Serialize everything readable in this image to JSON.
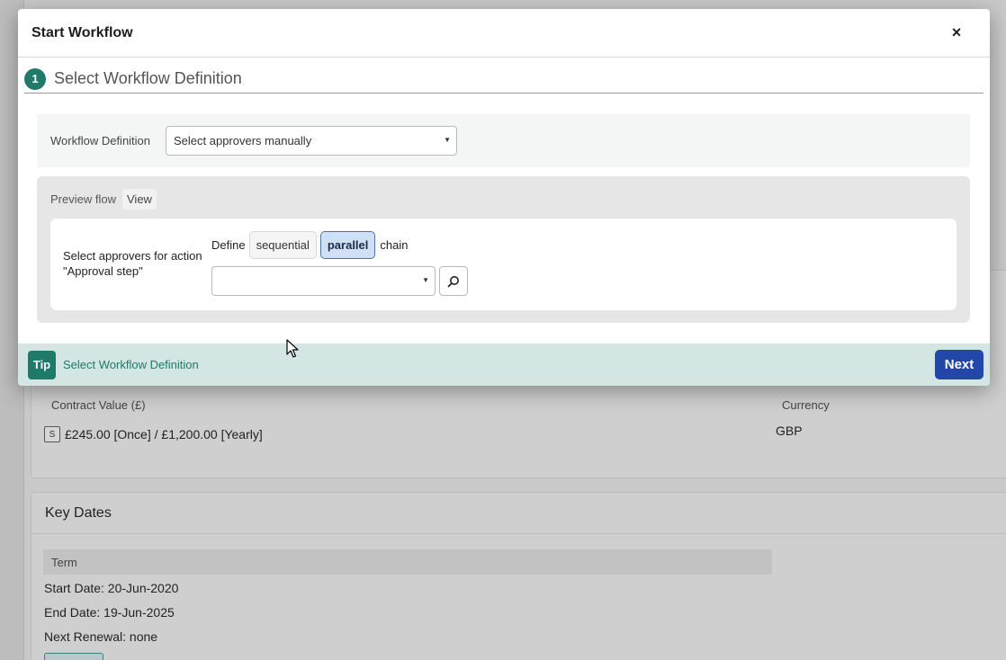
{
  "background": {
    "contract": {
      "value_label": "Contract Value (£)",
      "currency_label": "Currency",
      "value_badge": "S",
      "value_text": "£245.00 [Once] / £1,200.00 [Yearly]",
      "currency_value": "GBP"
    },
    "key_dates": {
      "heading": "Key Dates",
      "term_label": "Term",
      "start_date": "Start Date: 20-Jun-2020",
      "end_date": "End Date: 19-Jun-2025",
      "next_renewal": "Next Renewal: none"
    }
  },
  "modal": {
    "title": "Start Workflow",
    "close_glyph": "×",
    "step": {
      "number": "1",
      "title": "Select Workflow Definition"
    },
    "definition": {
      "label": "Workflow Definition",
      "selected": "Select approvers manually"
    },
    "preview": {
      "label": "Preview flow",
      "view_label": "View"
    },
    "approvers": {
      "label": "Select approvers for action \"Approval step\"",
      "define_label": "Define",
      "options": [
        "sequential",
        "parallel"
      ],
      "selected_option": "parallel",
      "chain_label": "chain",
      "select_value": ""
    },
    "tip": {
      "badge": "Tip",
      "text": "Select Workflow Definition"
    },
    "next_label": "Next"
  },
  "colors": {
    "accent_teal": "#1f7a6a",
    "primary_blue": "#2347a8",
    "tip_bg": "#d3e6e3"
  }
}
